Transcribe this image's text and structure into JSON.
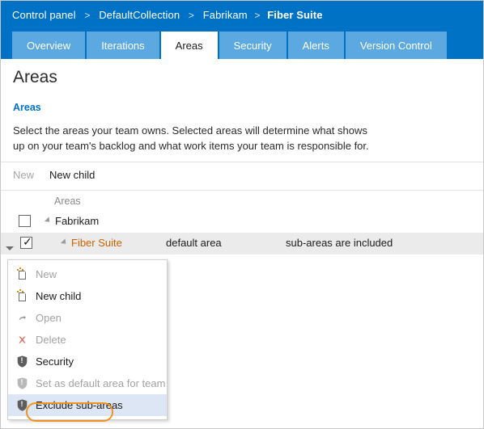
{
  "header": {
    "breadcrumb": {
      "items": [
        {
          "label": "Control panel",
          "current": false
        },
        {
          "label": "DefaultCollection",
          "current": false
        },
        {
          "label": "Fabrikam",
          "current": false
        },
        {
          "label": "Fiber Suite",
          "current": true
        }
      ],
      "separator": ">"
    },
    "background_color": "#0072c6"
  },
  "tabs": [
    {
      "label": "Overview",
      "active": false
    },
    {
      "label": "Iterations",
      "active": false
    },
    {
      "label": "Areas",
      "active": true
    },
    {
      "label": "Security",
      "active": false
    },
    {
      "label": "Alerts",
      "active": false
    },
    {
      "label": "Version Control",
      "active": false
    }
  ],
  "main": {
    "page_title": "Areas",
    "section_title": "Areas",
    "section_title_color": "#0072c6",
    "description": "Select the areas your team owns. Selected areas will determine what shows up on your team's backlog and what work items your team is responsible for."
  },
  "commandbar": {
    "commands": [
      {
        "label": "New",
        "enabled": false
      },
      {
        "label": "New child",
        "enabled": true
      }
    ]
  },
  "grid": {
    "columns": [
      "Areas",
      "",
      ""
    ],
    "header_label": "Areas",
    "rows": [
      {
        "label": "Fabrikam",
        "checked": false,
        "indent": 0,
        "default_area": "",
        "subareas": "",
        "selected": false,
        "is_default_area": false
      },
      {
        "label": "Fiber Suite",
        "checked": true,
        "indent": 1,
        "default_area": "default area",
        "subareas": "sub-areas are included",
        "selected": true,
        "is_default_area": true
      }
    ]
  },
  "context_menu": {
    "items": [
      {
        "label": "New",
        "icon": "new-page-icon",
        "enabled": false,
        "highlighted": false
      },
      {
        "label": "New child",
        "icon": "new-page-icon",
        "enabled": true,
        "highlighted": false
      },
      {
        "label": "Open",
        "icon": "open-arrow-icon",
        "enabled": false,
        "highlighted": false
      },
      {
        "label": "Delete",
        "icon": "delete-x-icon",
        "enabled": false,
        "highlighted": false
      },
      {
        "label": "Security",
        "icon": "shield-icon",
        "enabled": true,
        "highlighted": false
      },
      {
        "label": "Set as default area for team",
        "icon": "shield-icon",
        "enabled": false,
        "highlighted": false
      },
      {
        "label": "Exclude sub-areas",
        "icon": "shield-icon",
        "enabled": true,
        "highlighted": true
      }
    ]
  },
  "annotation": {
    "target": "Exclude sub-areas",
    "color": "#f0941e"
  }
}
